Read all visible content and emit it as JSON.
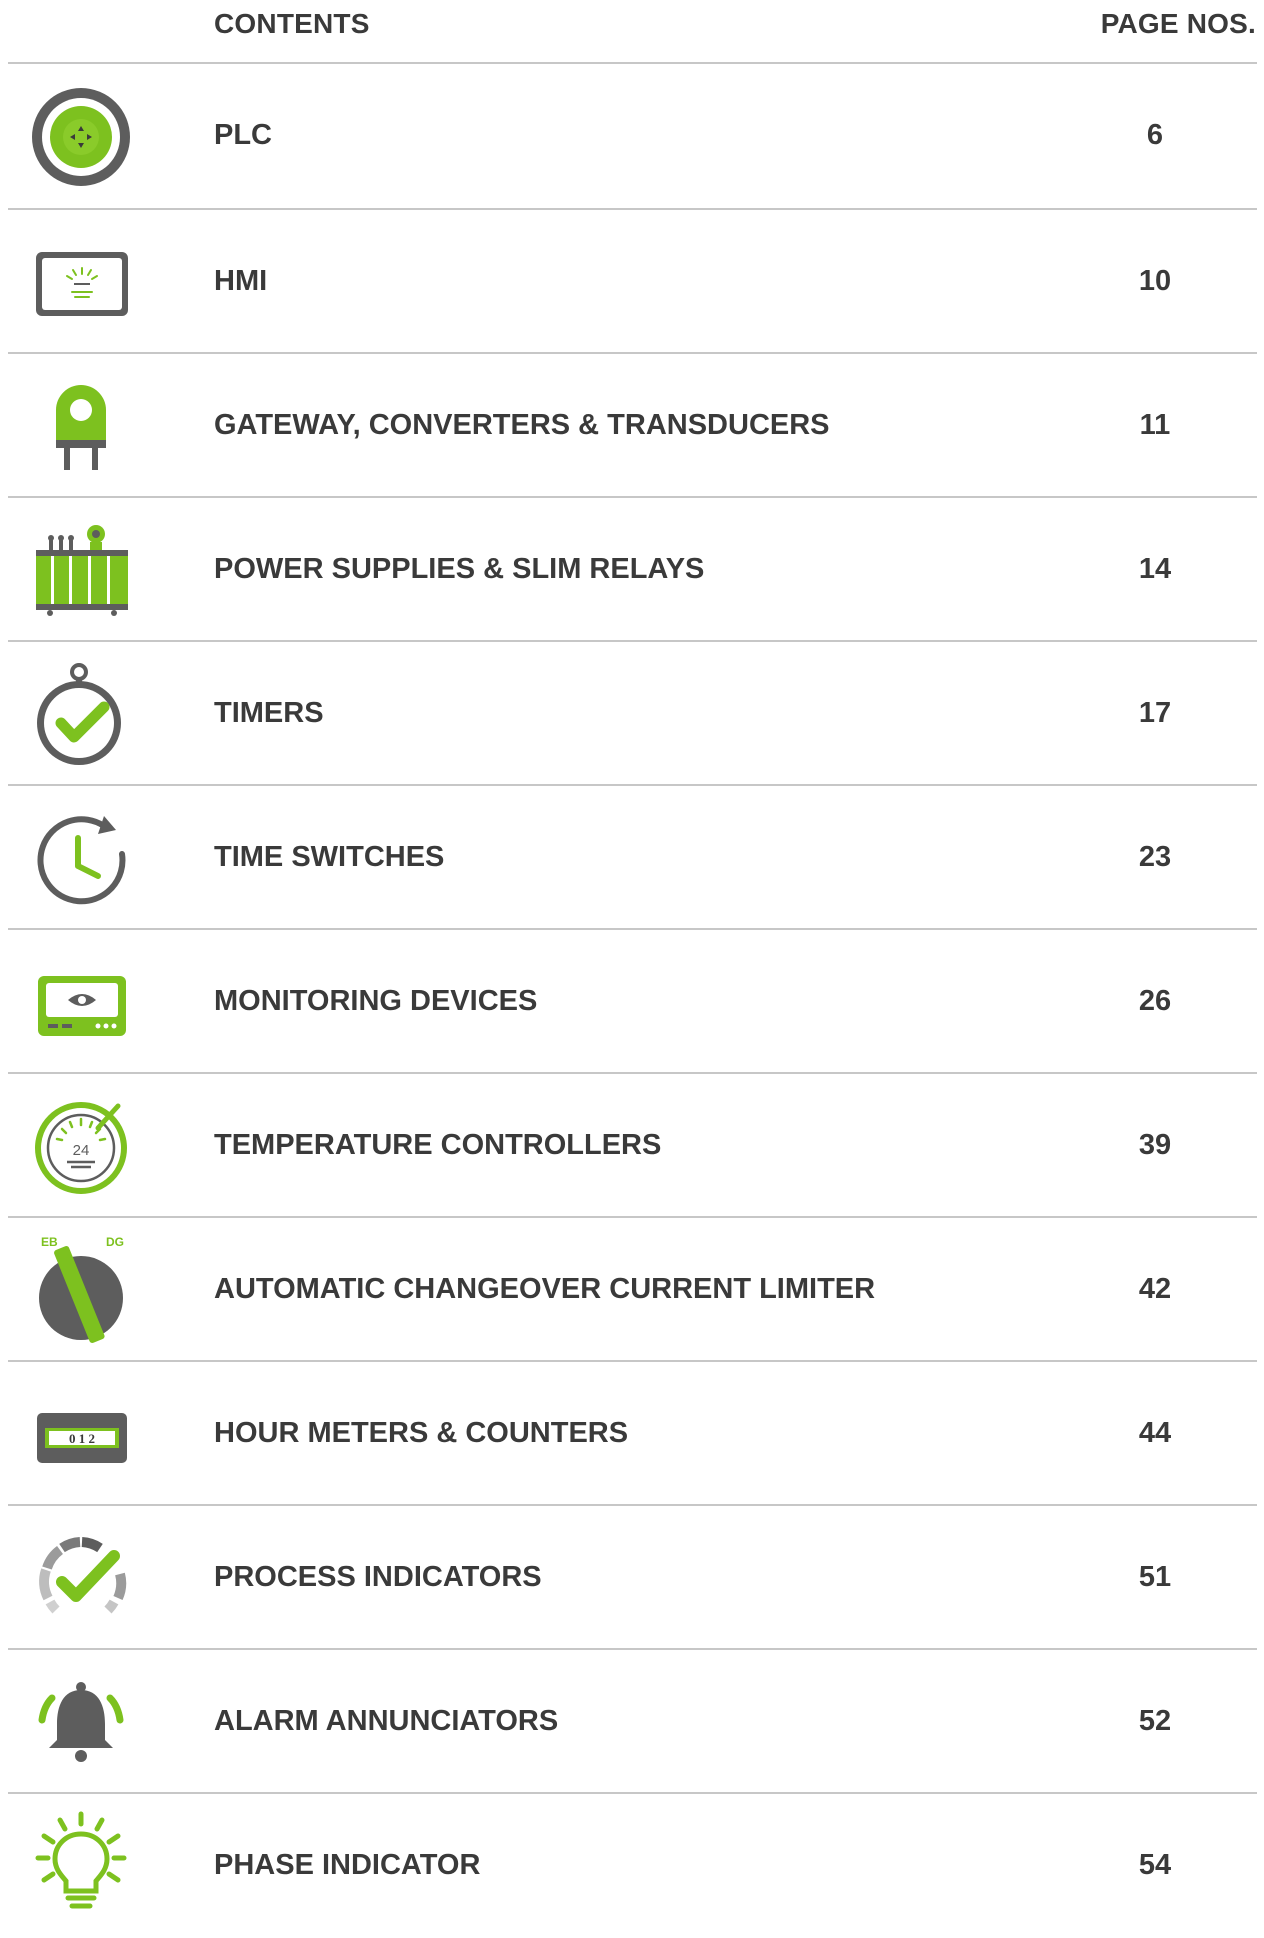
{
  "header": {
    "contents": "CONTENTS",
    "page_nos": "PAGE NOS."
  },
  "items": [
    {
      "label": "PLC",
      "page": "6",
      "icon": "plc-icon"
    },
    {
      "label": "HMI",
      "page": "10",
      "icon": "hmi-icon"
    },
    {
      "label": "GATEWAY, CONVERTERS & TRANSDUCERS",
      "page": "11",
      "icon": "gateway-plug-icon"
    },
    {
      "label": "POWER SUPPLIES & SLIM RELAYS",
      "page": "14",
      "icon": "power-supply-icon"
    },
    {
      "label": "TIMERS",
      "page": "17",
      "icon": "stopwatch-check-icon"
    },
    {
      "label": "TIME SWITCHES",
      "page": "23",
      "icon": "clock-refresh-icon"
    },
    {
      "label": "MONITORING DEVICES",
      "page": "26",
      "icon": "monitor-eye-icon"
    },
    {
      "label": "TEMPERATURE CONTROLLERS",
      "page": "39",
      "icon": "temperature-dial-icon",
      "dial_value": "24"
    },
    {
      "label": "AUTOMATIC CHANGEOVER CURRENT LIMITER",
      "page": "42",
      "icon": "changeover-switch-icon",
      "switch_left": "EB",
      "switch_right": "DG"
    },
    {
      "label": "HOUR METERS & COUNTERS",
      "page": "44",
      "icon": "counter-icon",
      "counter_digits": "0 1 2"
    },
    {
      "label": "PROCESS INDICATORS",
      "page": "51",
      "icon": "gauge-check-icon"
    },
    {
      "label": "ALARM ANNUNCIATORS",
      "page": "52",
      "icon": "alarm-bell-icon"
    },
    {
      "label": "PHASE INDICATOR",
      "page": "54",
      "icon": "light-bulb-icon"
    }
  ],
  "colors": {
    "green": "#7dc11f",
    "gray": "#5d5d5d",
    "text": "#3a3a3a",
    "rule": "#c7c7c7"
  }
}
